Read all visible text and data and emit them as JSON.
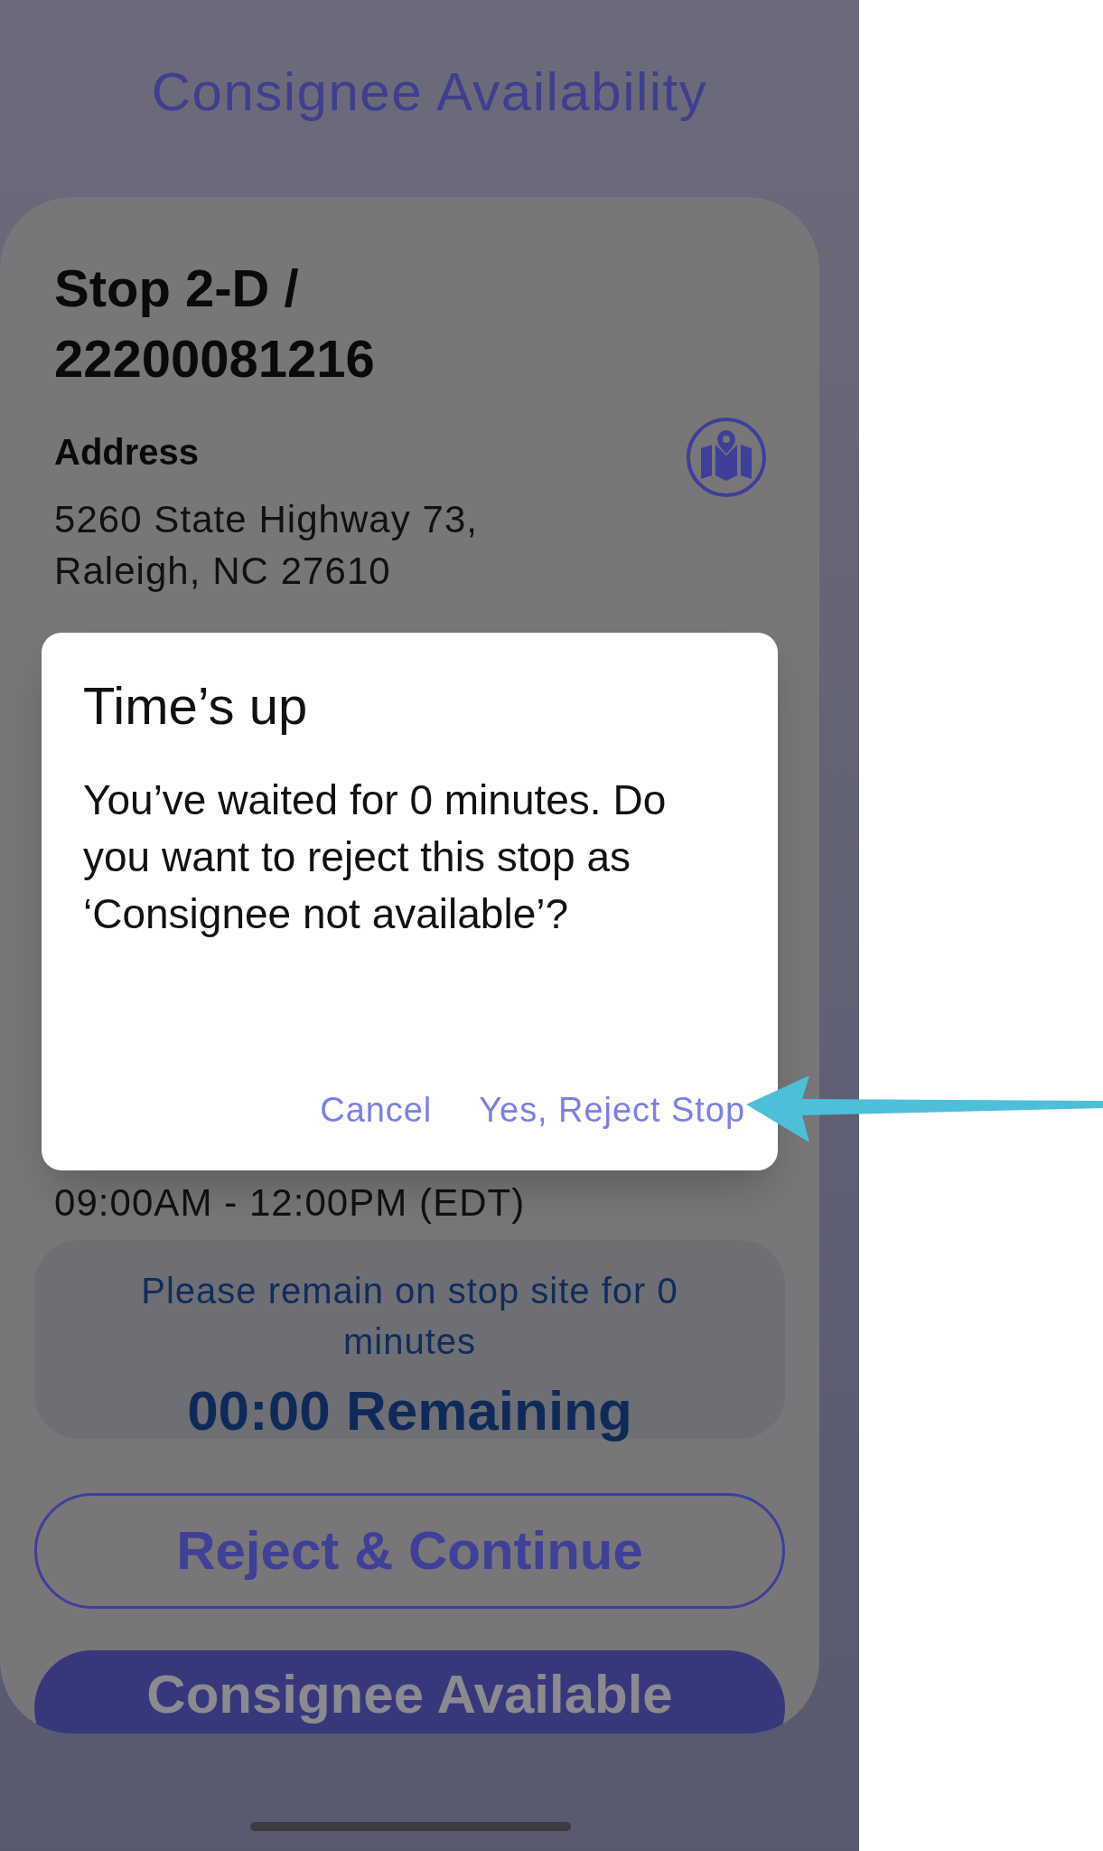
{
  "screen": {
    "title": "Consignee Availability"
  },
  "stop": {
    "title": "Stop 2-D / 22200081216",
    "address_label": "Address",
    "address": "5260 State Highway 73, Raleigh, NC 27610",
    "time_window": "09:00AM - 12:00PM (EDT)"
  },
  "timer": {
    "message": "Please remain on stop site for 0 minutes",
    "remaining": "00:00 Remaining"
  },
  "buttons": [
    {
      "label": "Reject & Continue",
      "kind": "outline"
    },
    {
      "label": "Consignee Available",
      "kind": "filled"
    }
  ],
  "dialog": {
    "title": "Time’s up",
    "message": "You’ve waited for 0 minutes. Do you want to reject this stop as ‘Consignee not available’?",
    "actions": [
      "Cancel",
      "Yes, Reject Stop"
    ]
  }
}
